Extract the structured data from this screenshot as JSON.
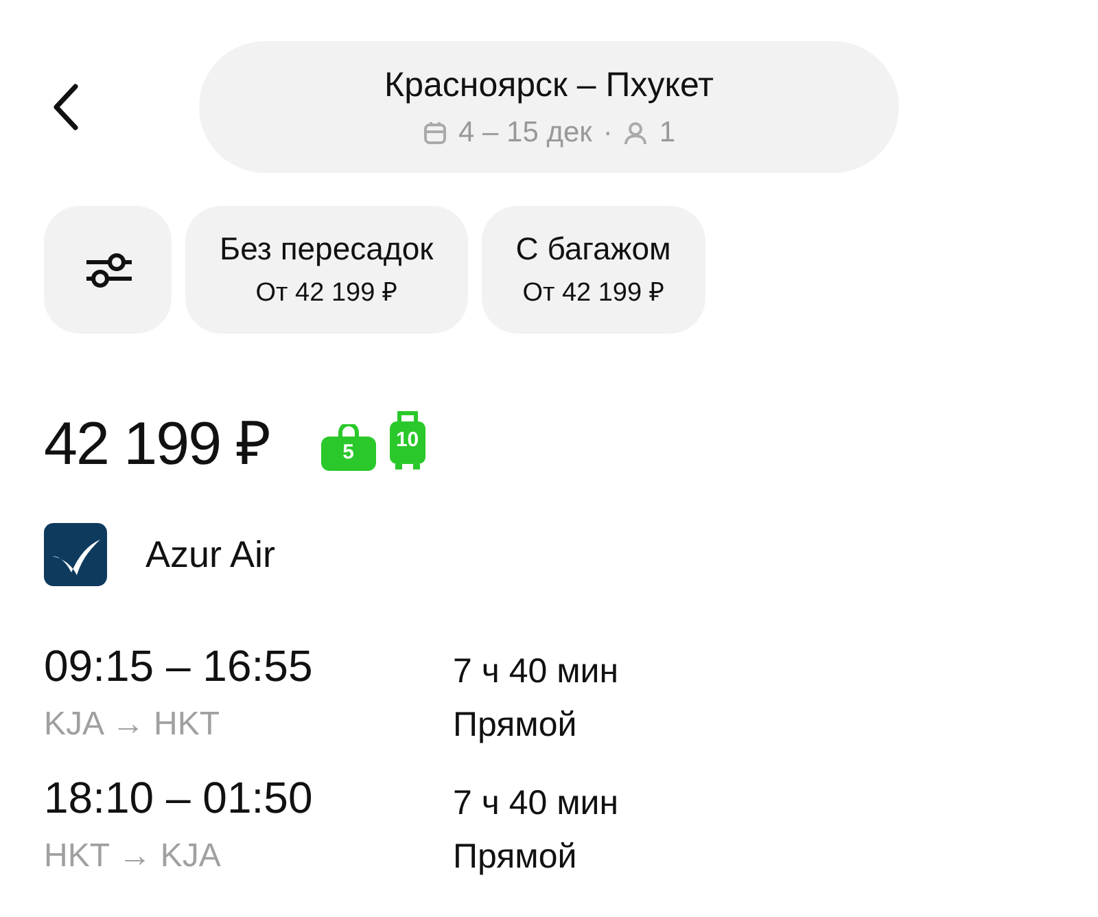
{
  "header": {
    "title": "Красноярск – Пхукет",
    "dates": "4 – 15 дек",
    "separator": "·",
    "passengers": "1"
  },
  "filters": [
    {
      "title": "Без пересадок",
      "price": "От 42 199 ₽"
    },
    {
      "title": "С багажом",
      "price": "От 42 199 ₽"
    }
  ],
  "offer": {
    "price": "42 199 ₽",
    "baggage": [
      {
        "kind": "hand",
        "count": "5"
      },
      {
        "kind": "checked",
        "count": "10"
      }
    ],
    "airline": "Azur Air"
  },
  "segments": [
    {
      "times": "09:15 – 16:55",
      "route": "KJA → HKT",
      "duration": "7 ч 40 мин",
      "stops": "Прямой"
    },
    {
      "times": "18:10 – 01:50",
      "route": "HKT → KJA",
      "duration": "7 ч 40 мин",
      "stops": "Прямой"
    }
  ]
}
